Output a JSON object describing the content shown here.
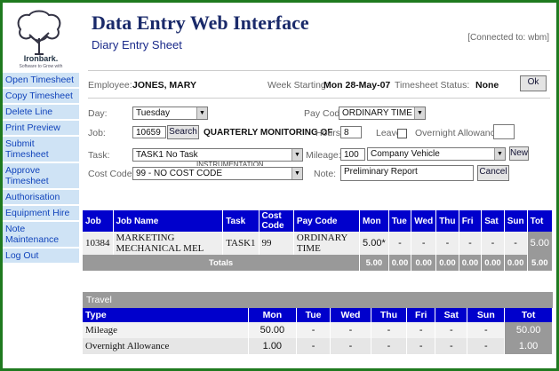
{
  "app": {
    "title": "Data Entry Web Interface",
    "subtitle": "Diary Entry Sheet",
    "connected": "[Connected to: wbm]"
  },
  "logo": {
    "name": "Ironbark.",
    "tagline": "Software to Grow with"
  },
  "sidebar": {
    "items": [
      {
        "label": "Open Timesheet"
      },
      {
        "label": "Copy Timesheet"
      },
      {
        "label": "Delete Line"
      },
      {
        "label": "Print Preview"
      },
      {
        "label": "Submit Timesheet"
      },
      {
        "label": "Approve Timesheet"
      },
      {
        "label": "Authorisation"
      },
      {
        "label": "Equipment Hire"
      },
      {
        "label": "Note Maintenance"
      },
      {
        "label": "Log Out"
      }
    ]
  },
  "header": {
    "employee_label": "Employee:",
    "employee": "JONES, MARY",
    "week_label": "Week Starting:",
    "week": "Mon 28-May-07",
    "status_label": "Timesheet Status:",
    "status": "None",
    "ok": "Ok"
  },
  "form": {
    "day_label": "Day:",
    "day": "Tuesday",
    "job_label": "Job:",
    "job": "10659",
    "search": "Search",
    "job_desc": "QUARTERLY MONITORING OF",
    "task_label": "Task:",
    "task": "TASK1 No Task",
    "task_overflow": "INSTRUMENTATION",
    "cost_label": "Cost Code:",
    "cost": "99 - NO COST CODE",
    "paycode_label": "Pay Code:",
    "paycode": "ORDINARY TIME",
    "hours_label": "Hours:",
    "hours": "8",
    "leave_label": "Leave",
    "overnight_label": "Overnight Allowance:",
    "overnight": "",
    "mileage_label": "Mileage:",
    "mileage": "100",
    "vehicle": "Company Vehicle",
    "new": "New",
    "note_label": "Note:",
    "note": "Preliminary Report",
    "cancel": "Cancel"
  },
  "entries": {
    "headers": [
      "Job",
      "Job Name",
      "Task",
      "Cost Code",
      "Pay Code",
      "Mon",
      "Tue",
      "Wed",
      "Thu",
      "Fri",
      "Sat",
      "Sun",
      "Tot"
    ],
    "rows": [
      [
        "10384",
        "MARKETING MECHANICAL MEL",
        "TASK1",
        "99",
        "ORDINARY TIME",
        "5.00*",
        "-",
        "-",
        "-",
        "-",
        "-",
        "-",
        "5.00"
      ]
    ],
    "totals_label": "Totals",
    "totals": [
      "5.00",
      "0.00",
      "0.00",
      "0.00",
      "0.00",
      "0.00",
      "0.00",
      "5.00"
    ]
  },
  "travel": {
    "caption": "Travel",
    "headers": [
      "Type",
      "Mon",
      "Tue",
      "Wed",
      "Thu",
      "Fri",
      "Sat",
      "Sun",
      "Tot"
    ],
    "rows": [
      [
        "Mileage",
        "50.00",
        "-",
        "-",
        "-",
        "-",
        "-",
        "-",
        "50.00"
      ],
      [
        "Overnight Allowance",
        "1.00",
        "-",
        "-",
        "-",
        "-",
        "-",
        "-",
        "1.00"
      ]
    ]
  },
  "colors": {
    "frame": "#1f7a1f",
    "header_blue": "#0000cc",
    "nav_bg": "#cfe3f5",
    "total_grey": "#999999"
  }
}
